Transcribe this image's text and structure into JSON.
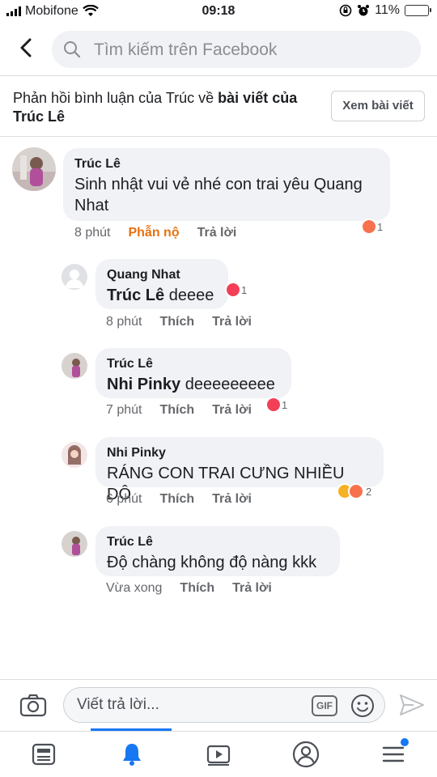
{
  "status_bar": {
    "carrier": "Mobifone",
    "time": "09:18",
    "battery": "11%",
    "battery_level": 0.11
  },
  "header": {
    "search_placeholder": "Tìm kiếm trên Facebook"
  },
  "reply_context": {
    "prefix": "Phản hồi bình luận của Trúc về ",
    "post_link": "bài viết của",
    "owner": "Trúc Lê",
    "view_post_label": "Xem bài viết"
  },
  "comments": [
    {
      "name": "Trúc Lê",
      "text": "Sinh nhật vui vẻ nhé con trai yêu Quang Nhat",
      "time": "8 phút",
      "action1": "Phẫn nộ",
      "reply": "Trả lời",
      "reaction_count": "1",
      "reaction": "angry"
    },
    {
      "name": "Quang Nhat",
      "tag": "Trúc Lê",
      "text": " deeee",
      "time": "8 phút",
      "action1": "Thích",
      "reply": "Trả lời",
      "reaction_count": "1",
      "reaction": "love"
    },
    {
      "name": "Trúc Lê",
      "tag": "Nhi Pinky",
      "text": " deeeeeeeee",
      "time": "7 phút",
      "action1": "Thích",
      "reply": "Trả lời",
      "reaction_count": "1",
      "reaction": "love"
    },
    {
      "name": "Nhi Pinky",
      "text": "RÁNG CON TRAI CƯNG NHIỀU DÔ",
      "time": "6 phút",
      "action1": "Thích",
      "reply": "Trả lời",
      "reaction_count": "2",
      "reaction": "haha-angry"
    },
    {
      "name": "Trúc Lê",
      "text": "Độ chàng không độ nàng kkk",
      "time": "Vừa xong",
      "action1": "Thích",
      "reply": "Trả lời"
    }
  ],
  "composer": {
    "placeholder": "Viết trả lời...",
    "gif_label": "GIF"
  },
  "colors": {
    "brand": "#1877f2",
    "angry": "#e9710f",
    "love": "#f33e58",
    "bubble": "#f0f2f5"
  }
}
